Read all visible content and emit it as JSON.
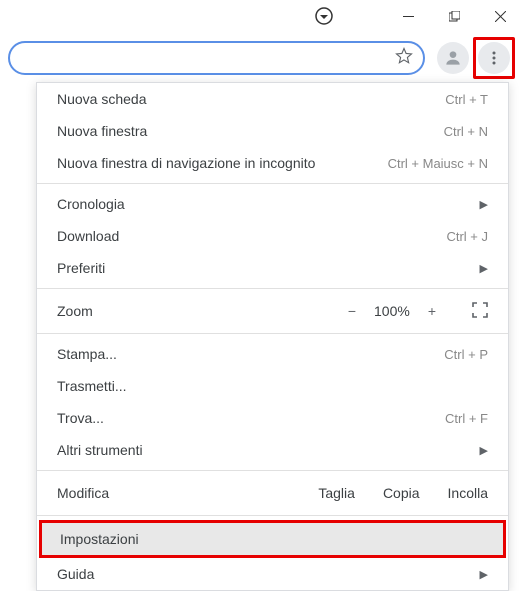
{
  "window": {
    "minimize": "−",
    "maximize": "",
    "close": ""
  },
  "menu": {
    "new_tab": "Nuova scheda",
    "new_tab_sc": "Ctrl + T",
    "new_window": "Nuova finestra",
    "new_window_sc": "Ctrl + N",
    "incognito": "Nuova finestra di navigazione in incognito",
    "incognito_sc": "Ctrl + Maiusc + N",
    "history": "Cronologia",
    "downloads": "Download",
    "downloads_sc": "Ctrl + J",
    "bookmarks": "Preferiti",
    "zoom": "Zoom",
    "zoom_minus": "−",
    "zoom_value": "100%",
    "zoom_plus": "+",
    "print": "Stampa...",
    "print_sc": "Ctrl + P",
    "cast": "Trasmetti...",
    "find": "Trova...",
    "find_sc": "Ctrl + F",
    "more_tools": "Altri strumenti",
    "edit": "Modifica",
    "cut": "Taglia",
    "copy": "Copia",
    "paste": "Incolla",
    "settings": "Impostazioni",
    "help": "Guida"
  }
}
